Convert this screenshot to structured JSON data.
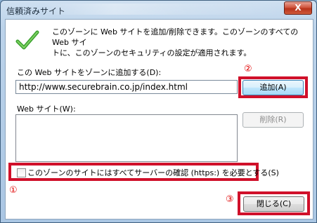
{
  "window": {
    "title": "信頼済みサイト",
    "close_label": "X"
  },
  "info": {
    "line1": "このゾーンに Web サイトを追加/削除できます。このゾーンのすべての Web サイ",
    "line2": "トに、このゾーンのセキュリティの設定が適用されます。"
  },
  "add_section": {
    "label": "この Web サイトをゾーンに追加する(D):",
    "url_value": "http://www.securebrain.co.jp/index.html",
    "add_button": "追加(A)"
  },
  "sites_section": {
    "label": "Web サイト(W):",
    "items": [],
    "remove_button": "削除(R)"
  },
  "https_option": {
    "label": "このゾーンのサイトにはすべてサーバーの確認 (https:) を必要とする(S)",
    "checked": false
  },
  "footer": {
    "close_button": "閉じる(C)"
  },
  "annotations": {
    "marker_1": "①",
    "marker_2": "②",
    "marker_3": "③",
    "highlight_color": "#d0102a"
  }
}
